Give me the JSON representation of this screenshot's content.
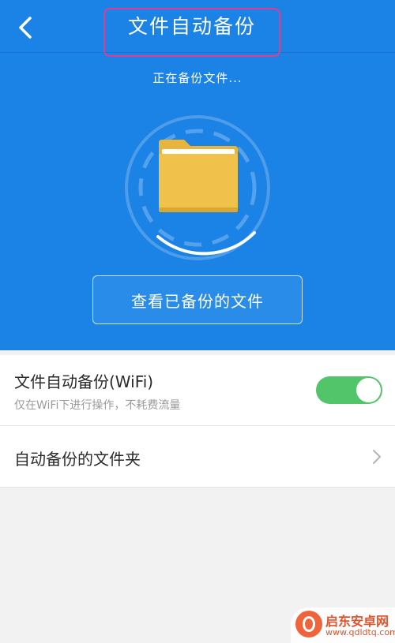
{
  "header": {
    "title": "文件自动备份",
    "status": "正在备份文件...",
    "view_button": "查看已备份的文件"
  },
  "settings": {
    "wifi_backup": {
      "title": "文件自动备份(WiFi)",
      "subtitle": "仅在WiFi下进行操作，不耗费流量",
      "enabled": true
    },
    "folder": {
      "title": "自动备份的文件夹"
    }
  },
  "watermark": {
    "name": "启东安卓网",
    "url": "www.qdldtq.com"
  },
  "colors": {
    "primary": "#1b82e6",
    "toggle_on": "#52c46a",
    "folder": "#f0c24c",
    "highlight": "#e33b92"
  }
}
